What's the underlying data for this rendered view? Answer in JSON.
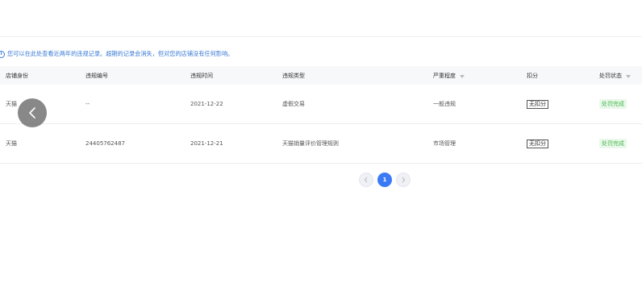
{
  "notice": {
    "icon": "info-icon",
    "text": "您可以在此处查看近两年的违规记录。超期的记录会消失，但对您的店铺没有任何影响。"
  },
  "table": {
    "columns": [
      "店铺身份",
      "违规编号",
      "违规时间",
      "违规类型",
      "严重程度",
      "扣分",
      "处罚状态"
    ],
    "rows": [
      {
        "shop": "天猫",
        "id": "--",
        "time": "2021-12-22",
        "type": "虚假交易",
        "severity": "一般违规",
        "deduction": "无扣分",
        "status": "处罚完成"
      },
      {
        "shop": "天猫",
        "id": "24405762487",
        "time": "2021-12-21",
        "type": "天猫销量评价管理规则",
        "severity": "市场管理",
        "deduction": "无扣分",
        "status": "处罚完成"
      }
    ]
  },
  "pagination": {
    "current": "1"
  },
  "colors": {
    "accent": "#3a7bf5",
    "notice": "#3a7bd5",
    "status_bg": "#e9f8ea",
    "status_text": "#4bb950"
  }
}
